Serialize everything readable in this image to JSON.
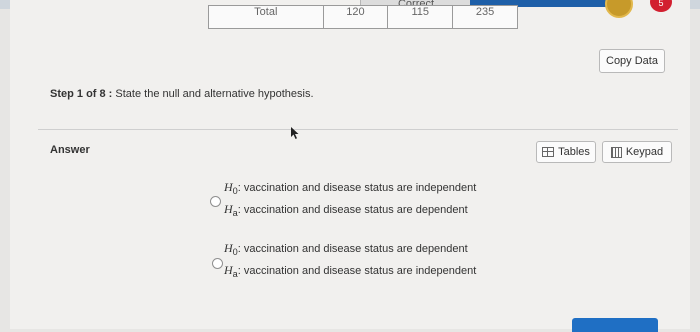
{
  "header": {
    "correct_label": "Correct",
    "badge_count": "5"
  },
  "total_row": {
    "label": "Total",
    "values": [
      "120",
      "115",
      "235"
    ]
  },
  "toolbar": {
    "copy_data_label": "Copy Data",
    "tables_label": "Tables",
    "keypad_label": "Keypad"
  },
  "step": {
    "number_label": "Step 1 of 8 :",
    "instruction": "State the null and alternative hypothesis."
  },
  "answer": {
    "label": "Answer",
    "options": [
      {
        "h0_symbol": "H",
        "h0_sub": "0",
        "h0_text": ": vaccination and disease status are independent",
        "ha_symbol": "H",
        "ha_sub": "a",
        "ha_text": ": vaccination and disease status are dependent"
      },
      {
        "h0_symbol": "H",
        "h0_sub": "0",
        "h0_text": ": vaccination and disease status are dependent",
        "ha_symbol": "H",
        "ha_sub": "a",
        "ha_text": ": vaccination and disease status are independent"
      }
    ]
  },
  "colors": {
    "accent_blue": "#1e5fa8",
    "badge_red": "#d21f2f"
  }
}
